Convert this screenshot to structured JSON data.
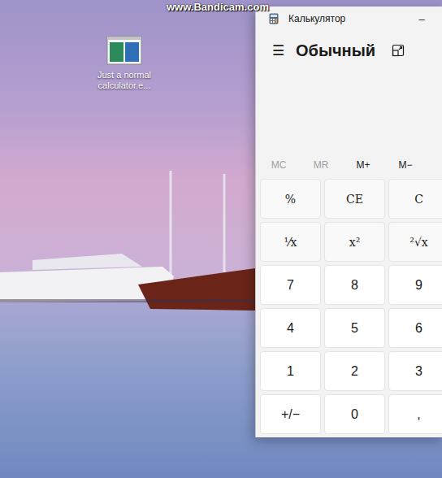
{
  "watermark": "www.Bandicam.com",
  "desktop_icons": [
    {
      "label": "Just a normal calculator.e..."
    }
  ],
  "window": {
    "title": "Калькулятор",
    "minimize": "–"
  },
  "header": {
    "menu": "☰",
    "mode": "Обычный"
  },
  "memory": [
    {
      "label": "MC",
      "disabled": true
    },
    {
      "label": "MR",
      "disabled": true
    },
    {
      "label": "M+",
      "disabled": false
    },
    {
      "label": "M−",
      "disabled": false
    }
  ],
  "keys": [
    {
      "label": "%",
      "kind": "function"
    },
    {
      "label": "CE",
      "kind": "function"
    },
    {
      "label": "C",
      "kind": "function"
    },
    {
      "label": "⅟x",
      "kind": "function"
    },
    {
      "label": "x²",
      "kind": "function"
    },
    {
      "label": "²√x",
      "kind": "function"
    },
    {
      "label": "7",
      "kind": "number"
    },
    {
      "label": "8",
      "kind": "number"
    },
    {
      "label": "9",
      "kind": "number"
    },
    {
      "label": "4",
      "kind": "number"
    },
    {
      "label": "5",
      "kind": "number"
    },
    {
      "label": "6",
      "kind": "number"
    },
    {
      "label": "1",
      "kind": "number"
    },
    {
      "label": "2",
      "kind": "number"
    },
    {
      "label": "3",
      "kind": "number"
    },
    {
      "label": "+/−",
      "kind": "number"
    },
    {
      "label": "0",
      "kind": "number"
    },
    {
      "label": ",",
      "kind": "number"
    }
  ]
}
